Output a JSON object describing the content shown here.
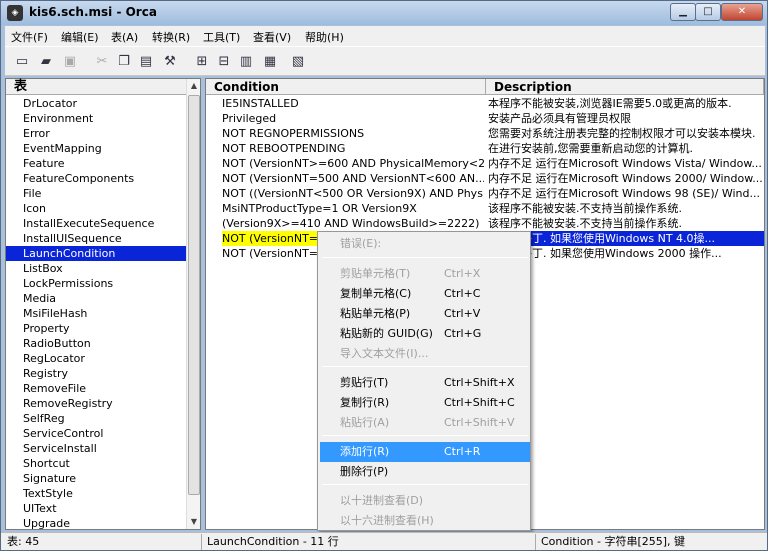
{
  "window": {
    "title": "kis6.sch.msi - Orca"
  },
  "menu": [
    "文件(F)",
    "编辑(E)",
    "表(A)",
    "转换(R)",
    "工具(T)",
    "查看(V)",
    "帮助(H)"
  ],
  "tables": {
    "header": "表",
    "items": [
      "DrLocator",
      "Environment",
      "Error",
      "EventMapping",
      "Feature",
      "FeatureComponents",
      "File",
      "Icon",
      "InstallExecuteSequence",
      "InstallUISequence",
      "LaunchCondition",
      "ListBox",
      "LockPermissions",
      "Media",
      "MsiFileHash",
      "Property",
      "RadioButton",
      "RegLocator",
      "Registry",
      "RemoveFile",
      "RemoveRegistry",
      "SelfReg",
      "ServiceControl",
      "ServiceInstall",
      "Shortcut",
      "Signature",
      "TextStyle",
      "UIText",
      "Upgrade"
    ],
    "selected": "LaunchCondition"
  },
  "grid": {
    "columns": [
      "Condition",
      "Description"
    ],
    "rows": [
      {
        "c": "IE5INSTALLED",
        "d": "本程序不能被安装,浏览器IE需要5.0或更高的版本."
      },
      {
        "c": "Privileged",
        "d": "安装产品必须具有管理员权限"
      },
      {
        "c": "NOT REGNOPERMISSIONS",
        "d": "您需要对系统注册表完整的控制权限才可以安装本模块."
      },
      {
        "c": "NOT REBOOTPENDING",
        "d": "在进行安装前,您需要重新启动您的计算机."
      },
      {
        "c": "NOT (VersionNT>=600 AND PhysicalMemory<2...",
        "d": "内存不足 运行在Microsoft Windows Vista/ Window..."
      },
      {
        "c": "NOT (VersionNT=500 AND VersionNT<600 AN...",
        "d": "内存不足 运行在Microsoft Windows 2000/ Window..."
      },
      {
        "c": "NOT ((VersionNT<500 OR Version9X) AND Phys...",
        "d": "内存不足 运行在Microsoft Windows 98 (SE)/ Wind..."
      },
      {
        "c": "MsiNTProductType=1 OR Version9X",
        "d": "该程序不能被安装.不支持当前操作系统."
      },
      {
        "c": "(Version9X>=410 AND WindowsBuild>=2222) ...",
        "d": "该程序不能被安装.不支持当前操作系统."
      },
      {
        "c": "NOT (VersionNT=4",
        "d": "没安装补丁. 如果您使用Windows NT 4.0操..."
      },
      {
        "c": "NOT (VersionNT=5",
        "d": "没安装补丁. 如果您使用Windows 2000 操作..."
      }
    ]
  },
  "context_menu": {
    "items": [
      {
        "label": "错误(E):",
        "shortcut": "",
        "disabled": true
      },
      {
        "label": "剪贴单元格(T)",
        "shortcut": "Ctrl+X",
        "disabled": true
      },
      {
        "label": "复制单元格(C)",
        "shortcut": "Ctrl+C",
        "disabled": false
      },
      {
        "label": "粘贴单元格(P)",
        "shortcut": "Ctrl+V",
        "disabled": false
      },
      {
        "label": "粘贴新的 GUID(G)",
        "shortcut": "Ctrl+G",
        "disabled": false
      },
      {
        "label": "导入文本文件(I)...",
        "shortcut": "",
        "disabled": true
      },
      {
        "label": "剪贴行(T)",
        "shortcut": "Ctrl+Shift+X",
        "disabled": false
      },
      {
        "label": "复制行(R)",
        "shortcut": "Ctrl+Shift+C",
        "disabled": false
      },
      {
        "label": "粘贴行(A)",
        "shortcut": "Ctrl+Shift+V",
        "disabled": true
      },
      {
        "label": "添加行(R)",
        "shortcut": "Ctrl+R",
        "disabled": false,
        "highlighted": true
      },
      {
        "label": "删除行(P)",
        "shortcut": "",
        "disabled": false
      },
      {
        "label": "以十进制查看(D)",
        "shortcut": "",
        "disabled": true
      },
      {
        "label": "以十六进制查看(H)",
        "shortcut": "",
        "disabled": true
      }
    ]
  },
  "status": {
    "tables_count": "表: 45",
    "table_rows": "LaunchCondition - 11 行",
    "column_info": "Condition - 字符串[255], 键"
  }
}
